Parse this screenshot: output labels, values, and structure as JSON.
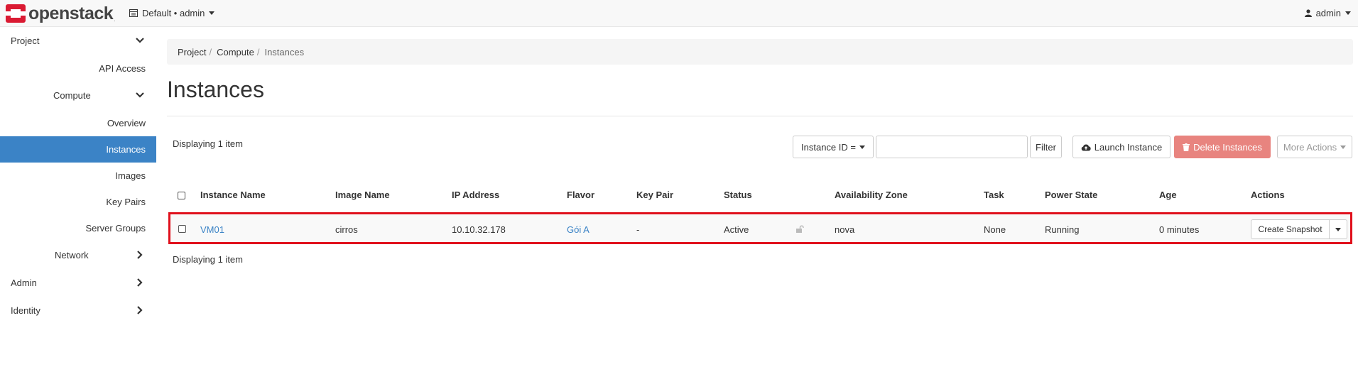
{
  "header": {
    "logo_text": "openstack",
    "logo_mark": ".",
    "project_switch": "Default • admin",
    "user": "admin"
  },
  "sidebar": {
    "project": "Project",
    "api_access": "API Access",
    "compute": "Compute",
    "overview": "Overview",
    "instances": "Instances",
    "images": "Images",
    "key_pairs": "Key Pairs",
    "server_groups": "Server Groups",
    "network": "Network",
    "admin": "Admin",
    "identity": "Identity"
  },
  "breadcrumb": {
    "project": "Project",
    "compute": "Compute",
    "current": "Instances",
    "sep": "/"
  },
  "page": {
    "title": "Instances"
  },
  "toolbar": {
    "filter_select": "Instance ID =",
    "filter_value": "",
    "filter_button": "Filter",
    "launch": "Launch Instance",
    "delete": "Delete Instances",
    "more": "More Actions"
  },
  "table": {
    "count_top": "Displaying 1 item",
    "count_bottom": "Displaying 1 item",
    "columns": [
      "Instance Name",
      "Image Name",
      "IP Address",
      "Flavor",
      "Key Pair",
      "Status",
      "Availability Zone",
      "Task",
      "Power State",
      "Age",
      "Actions"
    ],
    "rows": [
      {
        "name": "VM01",
        "image": "cirros",
        "ip": "10.10.32.178",
        "flavor": "Gói A",
        "key_pair": "-",
        "status": "Active",
        "zone": "nova",
        "task": "None",
        "power": "Running",
        "age": "0 minutes",
        "action": "Create Snapshot"
      }
    ]
  },
  "colors": {
    "accent": "#3b83c6",
    "danger": "#e8847f",
    "highlight": "#e0101c"
  }
}
